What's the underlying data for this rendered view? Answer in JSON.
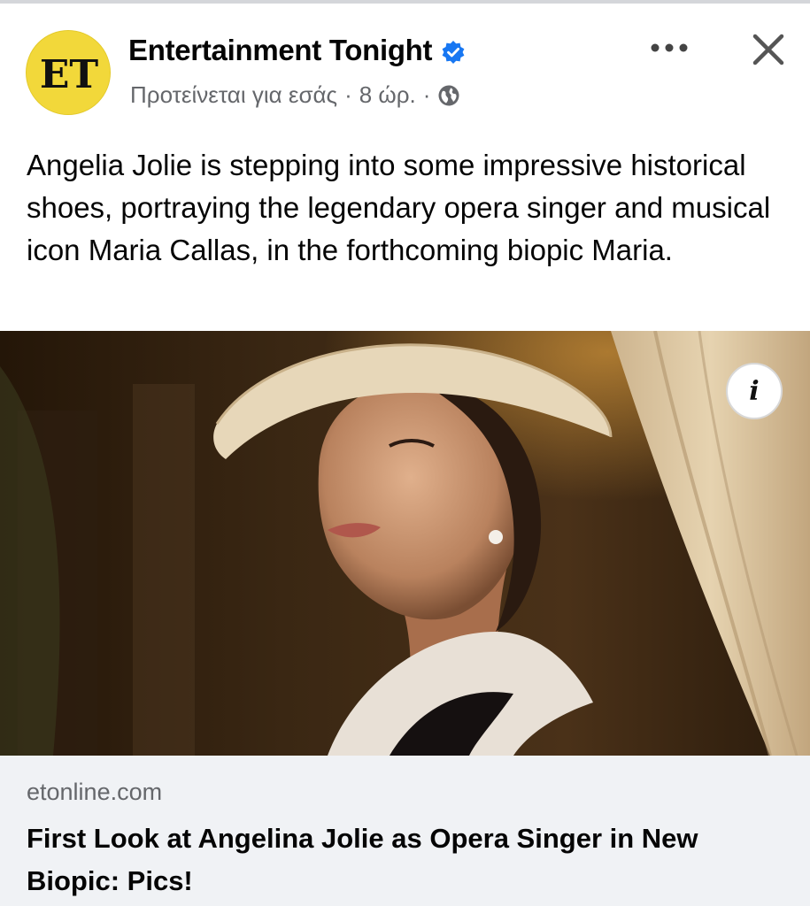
{
  "post": {
    "page_name": "Entertainment Tonight",
    "avatar_text": "ET",
    "subtitle_suggested": "Προτείνεται για εσάς",
    "separator": "·",
    "time": "8 ώρ.",
    "separator2": "·",
    "text": "Angelia Jolie is stepping into some impressive historical shoes, portraying the legendary opera singer and musical icon Maria Callas, in the forthcoming biopic Maria.",
    "icons": {
      "verified": "verified-badge-icon",
      "audience": "globe-icon",
      "more": "more-options-icon",
      "close": "close-icon",
      "info": "info-icon"
    },
    "info_glyph": "i"
  },
  "link": {
    "domain": "etonline.com",
    "title": "First Look at Angelina Jolie as Opera Singer in New Biopic: Pics!"
  },
  "colors": {
    "verified_blue": "#1877f2",
    "secondary_text": "#65676b",
    "link_preview_bg": "#f0f2f5",
    "avatar_yellow": "#f2d83a"
  }
}
